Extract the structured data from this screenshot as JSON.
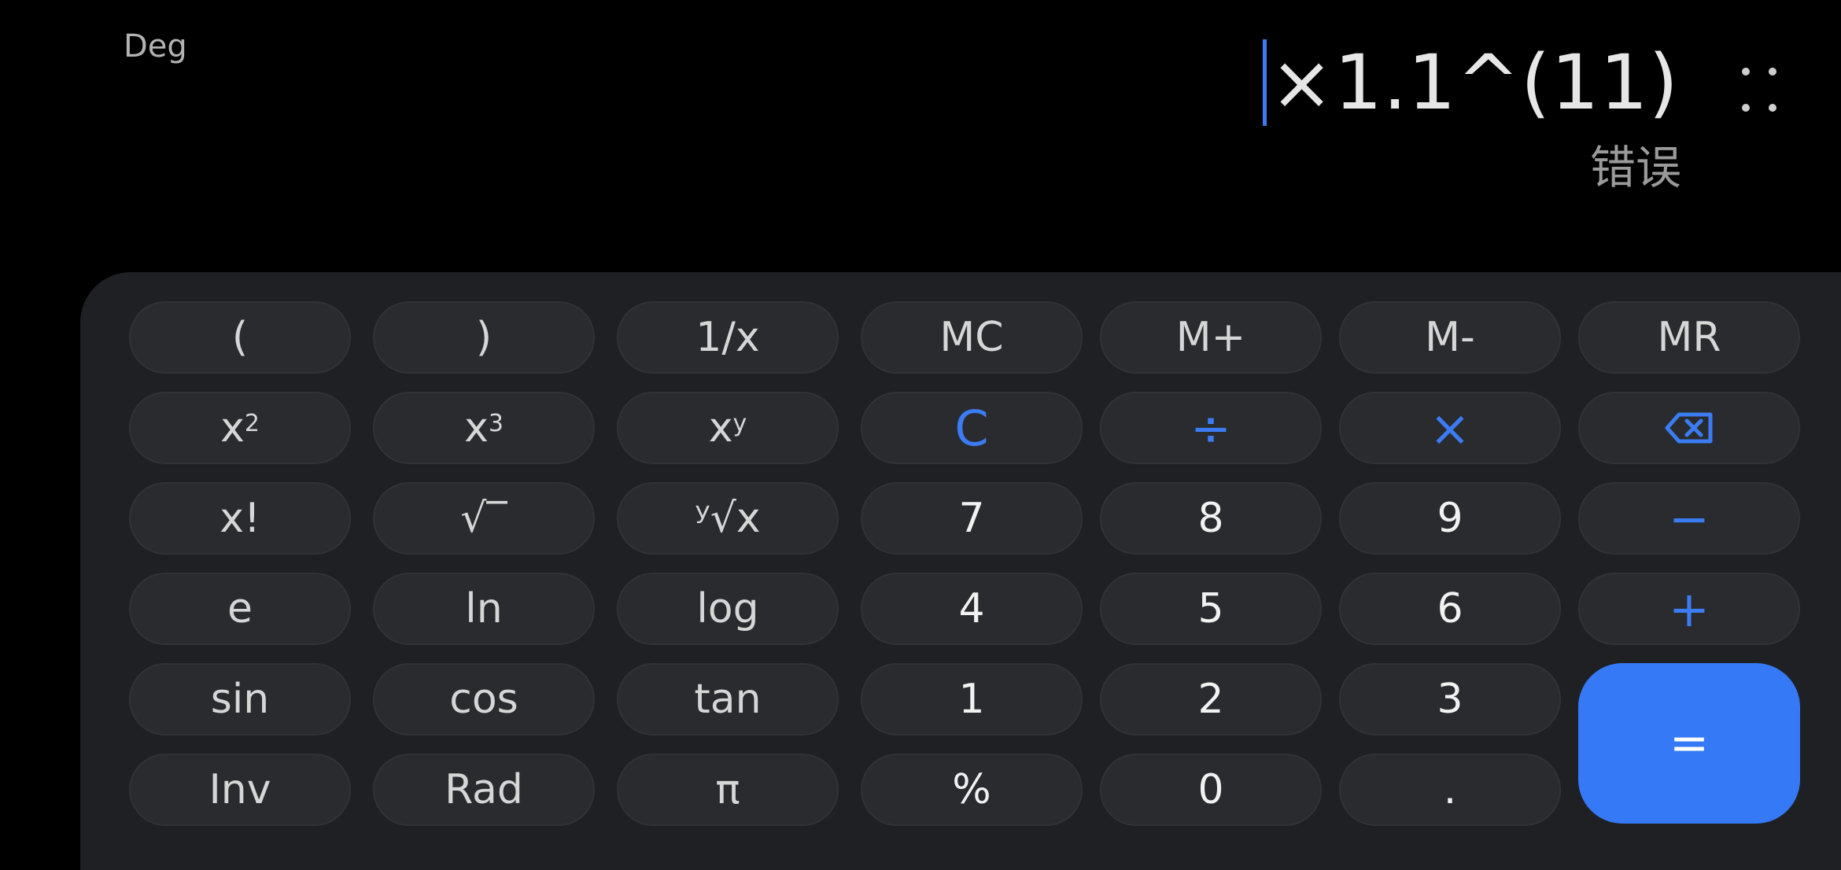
{
  "display": {
    "mode": "Deg",
    "expression": "×1.1^(11)",
    "result": "错误"
  },
  "icons": {
    "menu": "drag-dots-icon",
    "backspace": "backspace-icon"
  },
  "colors": {
    "accent": "#3579f6",
    "key_bg": "#2a2b2f",
    "pad_bg": "#1f2023"
  },
  "keys": {
    "open_paren": "(",
    "close_paren": ")",
    "reciprocal": "1/x",
    "mc": "MC",
    "m_plus": "M+",
    "m_minus": "M-",
    "mr": "MR",
    "x_square_base": "x",
    "x_square_sup": "2",
    "x_cube_base": "x",
    "x_cube_sup": "3",
    "x_pow_base": "x",
    "x_pow_sup": "y",
    "clear": "C",
    "divide": "÷",
    "multiply": "×",
    "factorial": "x!",
    "sqrt": "√‾",
    "yroot": "ʸ√x",
    "seven": "7",
    "eight": "8",
    "nine": "9",
    "minus": "−",
    "e": "e",
    "ln": "ln",
    "log": "log",
    "four": "4",
    "five": "5",
    "six": "6",
    "plus": "+",
    "sin": "sin",
    "cos": "cos",
    "tan": "tan",
    "one": "1",
    "two": "2",
    "three": "3",
    "equals": "=",
    "inv": "Inv",
    "rad": "Rad",
    "pi": "π",
    "percent": "%",
    "zero": "0",
    "dot": "."
  }
}
